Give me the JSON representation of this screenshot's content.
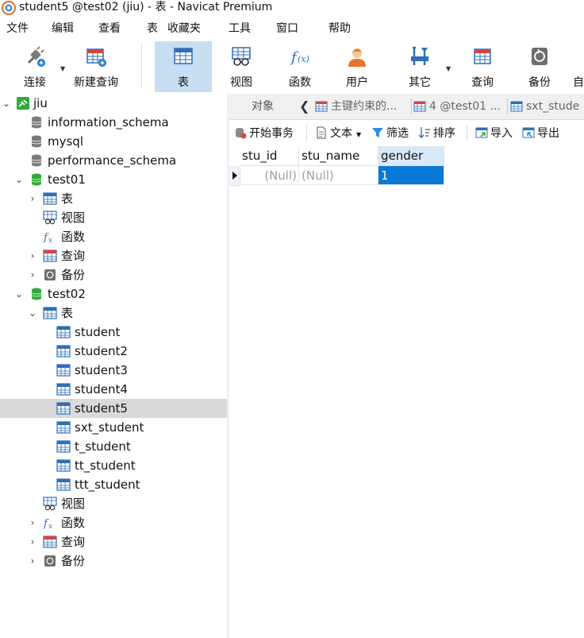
{
  "window": {
    "title": "student5 @test02 (jiu) - 表 - Navicat Premium"
  },
  "menu": [
    "文件",
    "编辑",
    "查看",
    "表",
    "收藏夹",
    "工具",
    "窗口",
    "帮助"
  ],
  "toolbar": {
    "connect": "连接",
    "new_query": "新建查询",
    "table": "表",
    "view": "视图",
    "function": "函数",
    "user": "用户",
    "other": "其它",
    "query": "查询",
    "backup": "备份",
    "auto": "自"
  },
  "tree": {
    "connection": "jiu",
    "items": [
      {
        "label": "information_schema",
        "icon": "database-icon"
      },
      {
        "label": "mysql",
        "icon": "database-icon"
      },
      {
        "label": "performance_schema",
        "icon": "database-icon"
      },
      {
        "label": "test01",
        "icon": "database-open-icon"
      },
      {
        "label": "表",
        "icon": "table-icon"
      },
      {
        "label": "视图",
        "icon": "view-icon"
      },
      {
        "label": "函数",
        "icon": "function-icon"
      },
      {
        "label": "查询",
        "icon": "query-icon"
      },
      {
        "label": "备份",
        "icon": "backup-icon"
      },
      {
        "label": "test02",
        "icon": "database-open-icon"
      },
      {
        "label": "表",
        "icon": "table-icon"
      },
      {
        "label": "student",
        "icon": "table-icon"
      },
      {
        "label": "student2",
        "icon": "table-icon"
      },
      {
        "label": "student3",
        "icon": "table-icon"
      },
      {
        "label": "student4",
        "icon": "table-icon"
      },
      {
        "label": "student5",
        "icon": "table-icon"
      },
      {
        "label": "sxt_student",
        "icon": "table-icon"
      },
      {
        "label": "t_student",
        "icon": "table-icon"
      },
      {
        "label": "tt_student",
        "icon": "table-icon"
      },
      {
        "label": "ttt_student",
        "icon": "table-icon"
      },
      {
        "label": "视图",
        "icon": "view-icon"
      },
      {
        "label": "函数",
        "icon": "function-icon"
      },
      {
        "label": "查询",
        "icon": "query-icon"
      },
      {
        "label": "备份",
        "icon": "backup-icon"
      }
    ]
  },
  "tabs": {
    "objects": "对象",
    "tab1": "主键约束的...",
    "tab2": "4 @test01 ...",
    "tab3": "sxt_stude"
  },
  "objbar": {
    "begin_tx": "开始事务",
    "text": "文本",
    "filter": "筛选",
    "sort": "排序",
    "import": "导入",
    "export": "导出"
  },
  "grid": {
    "columns": [
      "stu_id",
      "stu_name",
      "gender"
    ],
    "rows": [
      [
        "(Null)",
        "(Null)",
        "1"
      ]
    ]
  },
  "colors": {
    "selection": "#0a78d7",
    "active_tool": "#c7ddf2",
    "db_green": "#2eaa3a"
  }
}
